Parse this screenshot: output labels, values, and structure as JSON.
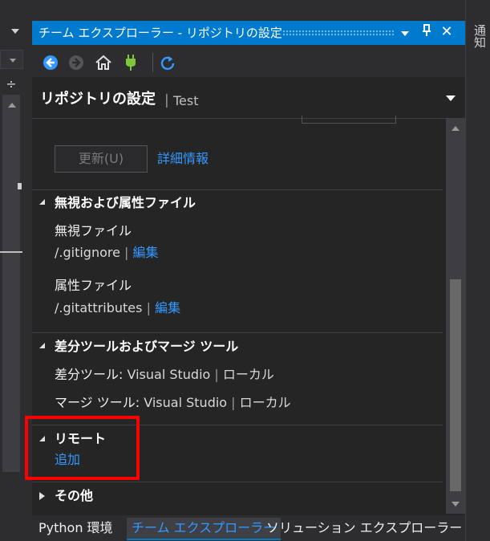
{
  "window": {
    "title": "チーム エクスプローラー - リポジトリの設定",
    "pin_glyph": "⊥",
    "close_glyph": "✕",
    "notifications_label": "通知"
  },
  "toolbar": {
    "icons": [
      "back-icon",
      "forward-icon",
      "home-icon",
      "connect-icon",
      "refresh-icon"
    ]
  },
  "header": {
    "title": "リポジトリの設定",
    "separator": "|",
    "subtitle": "Test"
  },
  "top_section": {
    "update_button": "更新(U)",
    "details_link": "詳細情報"
  },
  "ignore_section": {
    "title": "無視および属性ファイル",
    "ignore_label": "無視ファイル",
    "ignore_file": "/.gitignore",
    "ignore_sep": "|",
    "ignore_edit": "編集",
    "attr_label": "属性ファイル",
    "attr_file": "/.gitattributes",
    "attr_sep": "|",
    "attr_edit": "編集"
  },
  "diff_section": {
    "title": "差分ツールおよびマージ ツール",
    "diff_label": "差分ツール:",
    "diff_vs": "Visual Studio",
    "diff_sep": "|",
    "diff_local": "ローカル",
    "merge_label": "マージ ツール:",
    "merge_vs": "Visual Studio",
    "merge_sep": "|",
    "merge_local": "ローカル"
  },
  "remote_section": {
    "title": "リモート",
    "add_link": "追加"
  },
  "other_section": {
    "title": "その他"
  },
  "tabs": [
    {
      "label": "Python 環境",
      "active": false
    },
    {
      "label": "チーム エクスプローラー",
      "active": true
    },
    {
      "label": "ソリューション エクスプローラー",
      "active": false
    }
  ],
  "colors": {
    "accent": "#007acc",
    "link": "#3399ff",
    "highlight": "#ff0000",
    "panel_bg": "#252526"
  }
}
